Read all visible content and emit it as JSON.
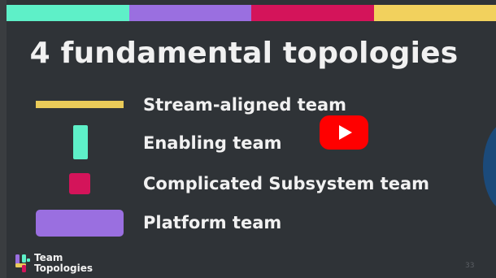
{
  "slide": {
    "title": "4 fundamental topologies",
    "top_bar_colors": [
      "#5ef0c8",
      "#9a6fe0",
      "#d4145a",
      "#f2d15d"
    ],
    "topologies": [
      {
        "label": "Stream-aligned team",
        "shape": "thin-horizontal-bar",
        "color": "#eacb59"
      },
      {
        "label": "Enabling team",
        "shape": "vertical-bar",
        "color": "#5ef0c8"
      },
      {
        "label": "Complicated Subsystem team",
        "shape": "small-square",
        "color": "#d4145a"
      },
      {
        "label": "Platform team",
        "shape": "wide-rectangle",
        "color": "#9a6fe0"
      }
    ],
    "logo": {
      "line1": "Team",
      "line2": "Topologies",
      "icon": "team-topologies-logo-icon"
    },
    "page_number": "33"
  },
  "player": {
    "play_button_icon": "youtube-play-icon",
    "play_button_color": "#ff0000"
  }
}
